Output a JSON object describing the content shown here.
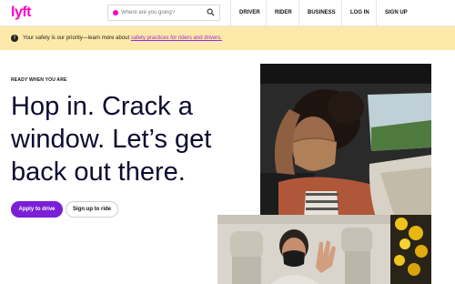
{
  "header": {
    "logo": "lyft",
    "search_placeholder": "Where are you going?",
    "nav": [
      "DRIVER",
      "RIDER",
      "BUSINESS",
      "LOG IN",
      "SIGN UP"
    ]
  },
  "banner": {
    "text": "Your safety is our priority—learn more about",
    "link": "safety practices for riders and drivers."
  },
  "hero": {
    "eyebrow": "READY WHEN YOU ARE",
    "headline_lines": [
      "Hop in. Crack a",
      "window. Let’s get",
      "back out there."
    ],
    "primary_button": "Apply to drive",
    "secondary_button": "Sign up to ride"
  },
  "colors": {
    "brand": "#ff00bf",
    "primary_button": "#7a1fd6",
    "banner_bg": "#fde9a9",
    "headline": "#0c0b31"
  },
  "icons": [
    "search-icon",
    "location-pin-icon",
    "warning-icon"
  ]
}
